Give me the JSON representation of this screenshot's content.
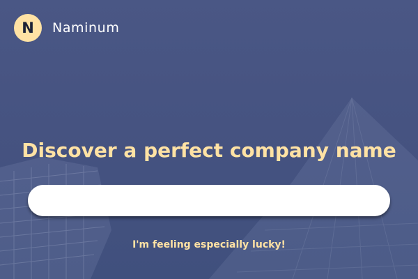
{
  "header": {
    "logo_letter": "N",
    "brand_name": "Naminum"
  },
  "main": {
    "headline": "Discover a perfect company name",
    "search": {
      "value": "",
      "placeholder": ""
    },
    "lucky_link": "I'm feeling especially lucky!"
  },
  "colors": {
    "background": "#465381",
    "accent": "#ffe2a4",
    "input_background": "#ffffff",
    "brand_text": "#ffffff"
  }
}
